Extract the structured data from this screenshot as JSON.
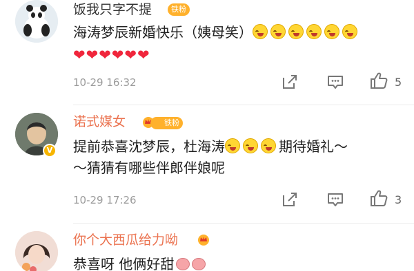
{
  "comments": [
    {
      "user": "饭我只字不提",
      "badge": "铁粉",
      "text": "海涛梦辰新婚快乐（姨母笑）",
      "hearts": "❤❤❤❤❤❤",
      "time": "10-29 16:32",
      "likes": "5"
    },
    {
      "user": "诺式媒女",
      "badge": "铁粉",
      "text_line1_a": "提前恭喜沈梦辰，杜海涛",
      "text_line1_b": "期待婚礼～",
      "text_line2": "～猜猜有哪些伴郎伴娘呢",
      "time": "10-29 17:26",
      "likes": "3"
    },
    {
      "user": "你个大西瓜给力呦",
      "text": "恭喜呀 他俩好甜"
    }
  ],
  "icons": {
    "share": "share-icon",
    "comment": "comment-icon",
    "like": "thumbs-up-icon",
    "crown": "crown-badge-icon",
    "verified": "verified-v-icon",
    "laugh": "laugh-cry-emoji",
    "pig": "pig-emoji"
  },
  "colors": {
    "accent_name": "#eb7350",
    "badge": "#ffb12c",
    "heart": "#f0263c",
    "meta": "#9b9b9b"
  }
}
